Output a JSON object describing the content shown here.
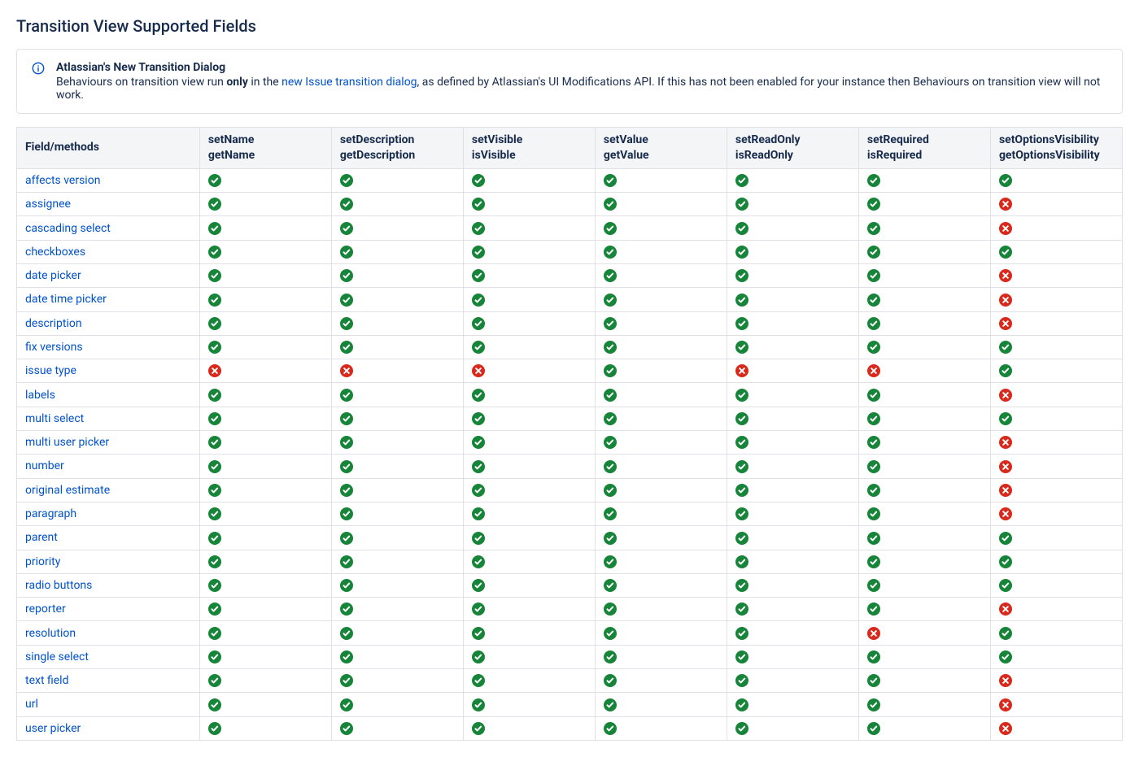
{
  "title": "Transition View Supported Fields",
  "info": {
    "heading": "Atlassian's New Transition Dialog",
    "text_pre": "Behaviours on transition view run ",
    "text_bold": "only",
    "text_mid": " in the ",
    "link_text": "new Issue transition dialog",
    "text_post": ", as defined by Atlassian's UI Modifications API. If this has not been enabled for your instance then Behaviours on transition view will not work."
  },
  "columns": [
    {
      "line1": "Field/methods",
      "line2": ""
    },
    {
      "line1": "setName",
      "line2": "getName"
    },
    {
      "line1": "setDescription",
      "line2": "getDescription"
    },
    {
      "line1": "setVisible",
      "line2": "isVisible"
    },
    {
      "line1": "setValue",
      "line2": "getValue"
    },
    {
      "line1": "setReadOnly",
      "line2": "isReadOnly"
    },
    {
      "line1": "setRequired",
      "line2": "isRequired"
    },
    {
      "line1": "setOptionsVisibility",
      "line2": "getOptionsVisibility"
    }
  ],
  "rows": [
    {
      "field": "affects version",
      "v": [
        true,
        true,
        true,
        true,
        true,
        true,
        true
      ]
    },
    {
      "field": "assignee",
      "v": [
        true,
        true,
        true,
        true,
        true,
        true,
        false
      ]
    },
    {
      "field": "cascading select",
      "v": [
        true,
        true,
        true,
        true,
        true,
        true,
        false
      ]
    },
    {
      "field": "checkboxes",
      "v": [
        true,
        true,
        true,
        true,
        true,
        true,
        true
      ]
    },
    {
      "field": "date picker",
      "v": [
        true,
        true,
        true,
        true,
        true,
        true,
        false
      ]
    },
    {
      "field": "date time picker",
      "v": [
        true,
        true,
        true,
        true,
        true,
        true,
        false
      ]
    },
    {
      "field": "description",
      "v": [
        true,
        true,
        true,
        true,
        true,
        true,
        false
      ]
    },
    {
      "field": "fix versions",
      "v": [
        true,
        true,
        true,
        true,
        true,
        true,
        true
      ]
    },
    {
      "field": "issue type",
      "v": [
        false,
        false,
        false,
        true,
        false,
        false,
        true
      ]
    },
    {
      "field": "labels",
      "v": [
        true,
        true,
        true,
        true,
        true,
        true,
        false
      ]
    },
    {
      "field": "multi select",
      "v": [
        true,
        true,
        true,
        true,
        true,
        true,
        true
      ]
    },
    {
      "field": "multi user picker",
      "v": [
        true,
        true,
        true,
        true,
        true,
        true,
        false
      ]
    },
    {
      "field": "number",
      "v": [
        true,
        true,
        true,
        true,
        true,
        true,
        false
      ]
    },
    {
      "field": "original estimate",
      "v": [
        true,
        true,
        true,
        true,
        true,
        true,
        false
      ]
    },
    {
      "field": "paragraph",
      "v": [
        true,
        true,
        true,
        true,
        true,
        true,
        false
      ]
    },
    {
      "field": "parent",
      "v": [
        true,
        true,
        true,
        true,
        true,
        true,
        true
      ]
    },
    {
      "field": "priority",
      "v": [
        true,
        true,
        true,
        true,
        true,
        true,
        true
      ]
    },
    {
      "field": "radio buttons",
      "v": [
        true,
        true,
        true,
        true,
        true,
        true,
        true
      ]
    },
    {
      "field": "reporter",
      "v": [
        true,
        true,
        true,
        true,
        true,
        true,
        false
      ]
    },
    {
      "field": "resolution",
      "v": [
        true,
        true,
        true,
        true,
        true,
        false,
        true
      ]
    },
    {
      "field": "single select",
      "v": [
        true,
        true,
        true,
        true,
        true,
        true,
        true
      ]
    },
    {
      "field": "text field",
      "v": [
        true,
        true,
        true,
        true,
        true,
        true,
        false
      ]
    },
    {
      "field": "url",
      "v": [
        true,
        true,
        true,
        true,
        true,
        true,
        false
      ]
    },
    {
      "field": "user picker",
      "v": [
        true,
        true,
        true,
        true,
        true,
        true,
        false
      ]
    }
  ],
  "icons": {
    "supported": "supported",
    "unsupported": "unsupported"
  },
  "colors": {
    "green": "#178539",
    "red": "#D9291C",
    "link": "#0052CC"
  }
}
